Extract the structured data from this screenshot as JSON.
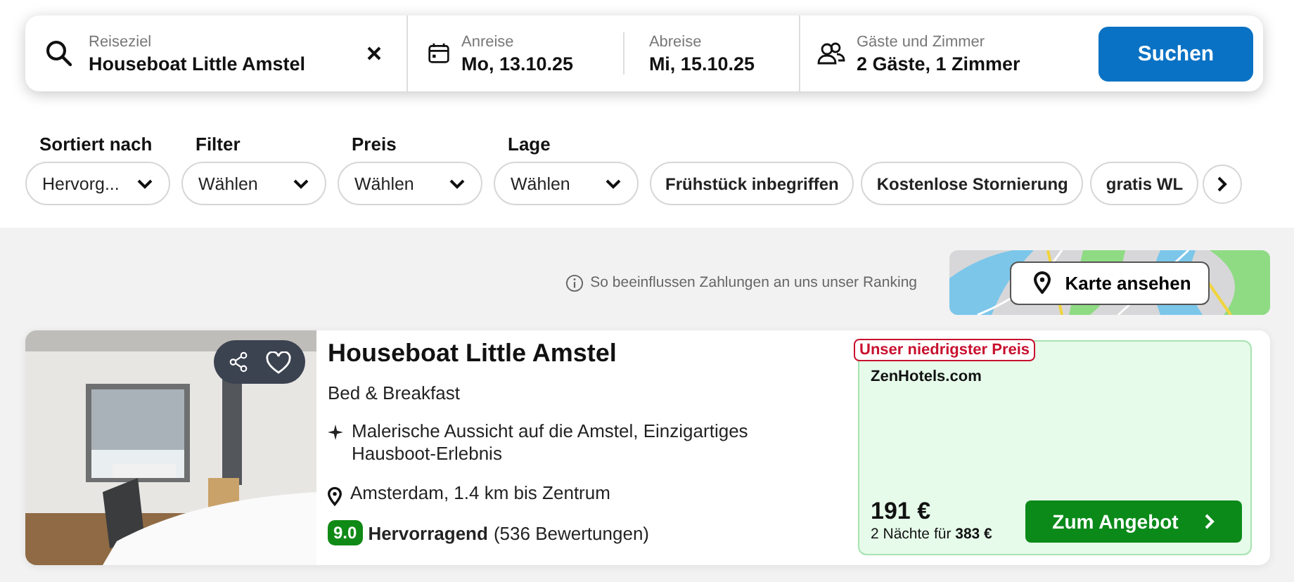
{
  "search": {
    "destination": {
      "label": "Reiseziel",
      "value": "Houseboat Little Amstel"
    },
    "checkin": {
      "label": "Anreise",
      "value": "Mo, 13.10.25"
    },
    "checkout": {
      "label": "Abreise",
      "value": "Mi, 15.10.25"
    },
    "guests": {
      "label": "Gäste und Zimmer",
      "value": "2 Gäste, 1 Zimmer"
    },
    "button": "Suchen"
  },
  "filters": [
    {
      "label": "Sortiert nach",
      "value": "Hervorg..."
    },
    {
      "label": "Filter",
      "value": "Wählen"
    },
    {
      "label": "Preis",
      "value": "Wählen"
    },
    {
      "label": "Lage",
      "value": "Wählen"
    }
  ],
  "chips": [
    "Frühstück inbegriffen",
    "Kostenlose Stornierung",
    "gratis WL"
  ],
  "ranking_note": "So beeinflussen Zahlungen an uns unser Ranking",
  "map_button": "Karte ansehen",
  "listing": {
    "name": "Houseboat Little Amstel",
    "type": "Bed & Breakfast",
    "highlight": "Malerische Aussicht auf die Amstel, Einzigartiges Hausboot-Erlebnis",
    "location": "Amsterdam, 1.4 km bis Zentrum",
    "rating": {
      "score": "9.0",
      "label": "Hervorragend",
      "count": "(536 Bewertungen)"
    },
    "offer": {
      "badge": "Unser niedrigster Preis",
      "provider": "ZenHotels.com",
      "price": "191 €",
      "total": "2 Nächte für **383 €**",
      "button": "Zum Angebot"
    }
  }
}
